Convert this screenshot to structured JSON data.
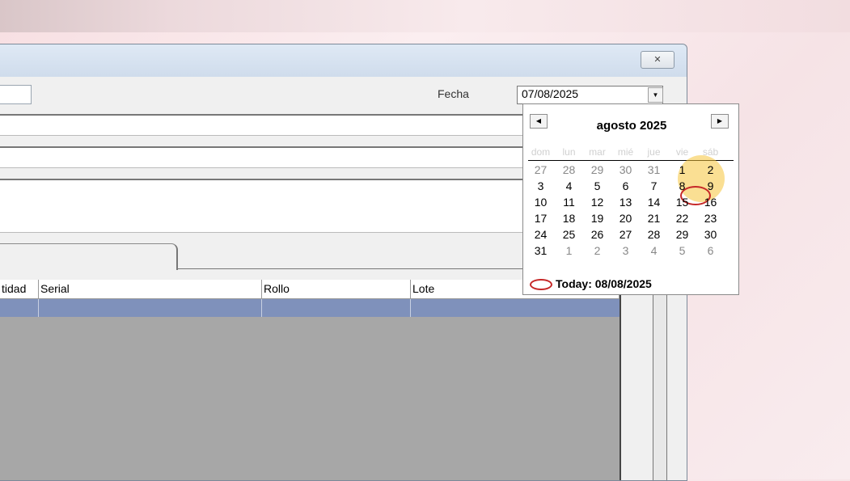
{
  "window": {
    "close_glyph": "✕",
    "fecha_label": "Fecha",
    "fecha_value": "07/08/2025",
    "dropdown_glyph": "▼"
  },
  "grid": {
    "columns": [
      "tidad",
      "Serial",
      "Rollo",
      "Lote"
    ]
  },
  "calendar": {
    "month_title": "agosto 2025",
    "prev_glyph": "◀",
    "next_glyph": "▶",
    "weekdays": [
      "dom",
      "lun",
      "mar",
      "mié",
      "jue",
      "vie",
      "sáb"
    ],
    "weeks": [
      [
        "27",
        "28",
        "29",
        "30",
        "31",
        "1",
        "2"
      ],
      [
        "3",
        "4",
        "5",
        "6",
        "7",
        "8",
        "9"
      ],
      [
        "10",
        "11",
        "12",
        "13",
        "14",
        "15",
        "16"
      ],
      [
        "17",
        "18",
        "19",
        "20",
        "21",
        "22",
        "23"
      ],
      [
        "24",
        "25",
        "26",
        "27",
        "28",
        "29",
        "30"
      ],
      [
        "31",
        "1",
        "2",
        "3",
        "4",
        "5",
        "6"
      ]
    ],
    "today_label": "Today: 08/08/2025",
    "selected_day": "8"
  },
  "colors": {
    "selected_row": "#7f91bb",
    "today_marker": "#c62828",
    "highlight": "#f6c43a"
  }
}
